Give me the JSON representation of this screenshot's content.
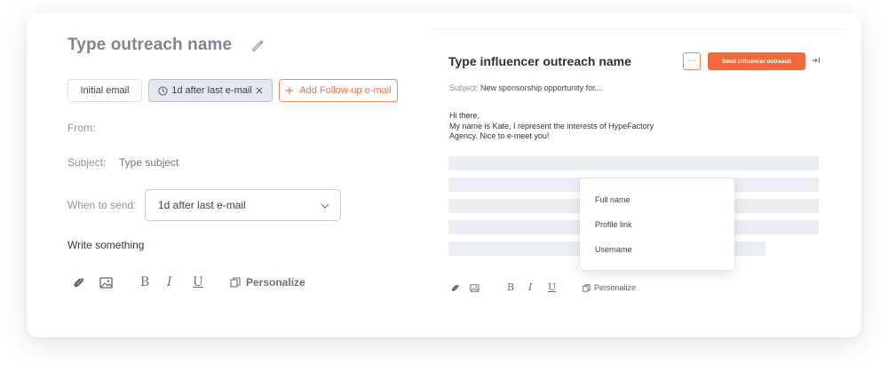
{
  "colors": {
    "accent": "#f26a3c",
    "chip_active_bg": "#e3e7f0",
    "bar": "#ebeef3"
  },
  "left": {
    "outreach_title": "Type outreach name",
    "chips": {
      "initial": "Initial email",
      "followup": "1d after last e-mail",
      "add": "Add Follow-up e-mail"
    },
    "from_label": "From:",
    "subject_label": "Subject:",
    "subject_placeholder": "Type subject",
    "when_label": "When to send:",
    "when_value": "1d after last e-mail",
    "write_label": "Write something",
    "toolbar": {
      "bold": "B",
      "italic": "I",
      "underline": "U",
      "personalize": "Personalize"
    },
    "icons": [
      "paperclip-icon",
      "image-icon",
      "clock-icon",
      "close-icon",
      "plus-icon",
      "chevron-down-icon",
      "edit-icon",
      "copy-icon"
    ]
  },
  "right": {
    "title": "Type influencer outreach name",
    "more_label": "···",
    "send_label": "Send influencer outreach",
    "subject_label": "Subject:",
    "subject_value": "New sponsorship opportunity for...",
    "body": {
      "line1": "Hi there,",
      "line2": "My name is Kate, I represent the interests of HypeFactory",
      "line3": "Agency. Nice to e-meet you!"
    },
    "dropdown": [
      "Full name",
      "Profile link",
      "Username"
    ],
    "toolbar": {
      "bold": "B",
      "italic": "I",
      "underline": "U",
      "personalize": "Personalize"
    }
  }
}
